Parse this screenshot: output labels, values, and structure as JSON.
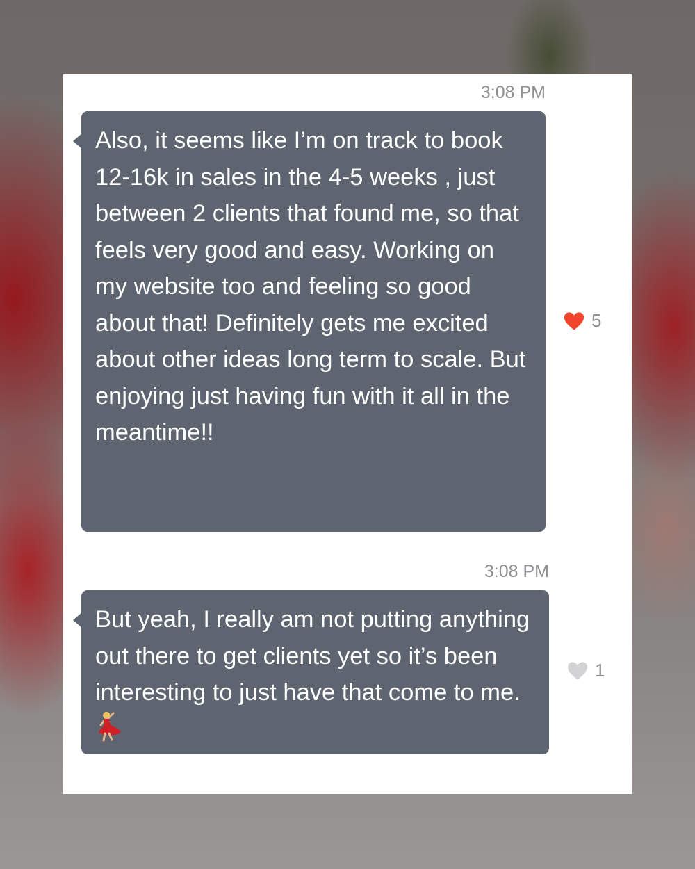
{
  "messages": [
    {
      "time": "3:08 PM",
      "text": "Also, it seems like I’m on track to book 12-16k in sales in the 4-5 weeks , just between 2 clients that found me, so that feels very good and easy. Working on my website too and feeling so good about that! Definitely gets me excited about other ideas long term to scale. But enjoying just having fun with it all in the meantime!!",
      "likes": "5",
      "liked": true,
      "heart_color": "#f0442c"
    },
    {
      "time": "3:08 PM",
      "text": "But yeah, I really am not putting anything out there to get clients yet so it’s been interesting to just have that come to me.",
      "likes": "1",
      "liked": false,
      "heart_color": "#d3d3d6",
      "trailing_icon": "dancing-woman-emoji"
    }
  ],
  "colors": {
    "bubble": "#5e6570",
    "bubble_text": "#ffffff",
    "timestamp": "#8e8e93",
    "card": "#ffffff"
  }
}
